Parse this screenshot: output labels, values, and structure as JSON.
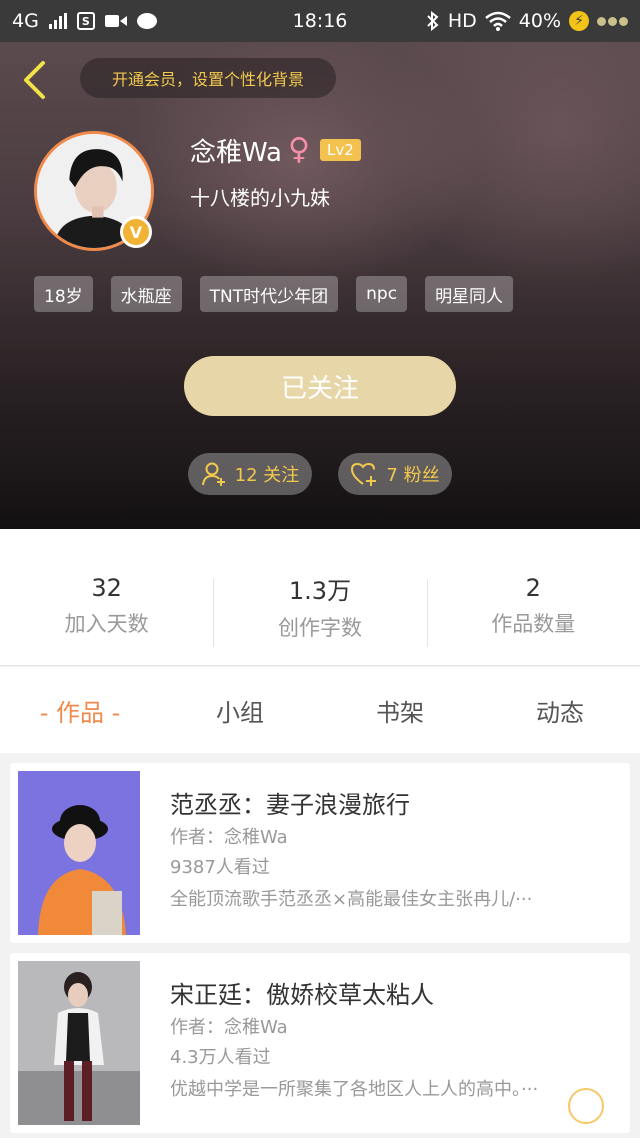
{
  "status_bar": {
    "network": "4G",
    "time": "18:16",
    "hd": "HD",
    "battery": "40%",
    "sim_badge": "S"
  },
  "header": {
    "member_prompt": "开通会员，设置个性化背景",
    "username": "念稚Wa",
    "gender_symbol": "♀",
    "level": "Lv2",
    "verified_badge": "V",
    "signature": "十八楼的小九妹",
    "tags": [
      "18岁",
      "水瓶座",
      "TNT时代少年团",
      "npc",
      "明星同人"
    ],
    "follow_button": "已关注",
    "following_label": "12 关注",
    "fans_label": "7 粉丝"
  },
  "stats": [
    {
      "value": "32",
      "label": "加入天数"
    },
    {
      "value": "1.3万",
      "label": "创作字数"
    },
    {
      "value": "2",
      "label": "作品数量"
    }
  ],
  "tabs": [
    "- 作品 -",
    "小组",
    "书架",
    "动态"
  ],
  "works": [
    {
      "title": "范丞丞：妻子浪漫旅行",
      "author": "作者：念稚Wa",
      "views": "9387人看过",
      "desc": "全能顶流歌手范丞丞×高能最佳女主张冉儿/···"
    },
    {
      "title": "宋正廷：傲娇校草太粘人",
      "author": "作者：念稚Wa",
      "views": "4.3万人看过",
      "desc": "优越中学是一所聚集了各地区人上人的高中。···"
    }
  ],
  "colors": {
    "accent": "#f08a4b",
    "gold": "#f2c94c",
    "follow_button_bg": "#e7d7a8"
  },
  "icons": [
    "back-arrow-icon",
    "person-plus-icon",
    "heart-plus-icon",
    "wifi-icon",
    "bluetooth-icon"
  ]
}
